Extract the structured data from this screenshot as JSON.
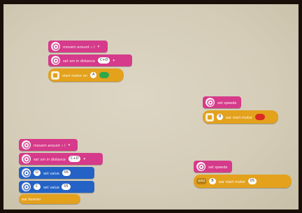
{
  "workspace": {
    "stack_top": {
      "block1": {
        "text": "ꞁ ∘ ʇunouɐ ɯǝʌoɯ",
        "dir": "▾"
      },
      "block2": {
        "text": "ǝɔuɐʇsᴉp uᴉ ɯʌ ʇǝs",
        "port": "C+D",
        "dir": "▾"
      },
      "block3": {
        "text": "uo ɹoʇoɯ ʇɹɐʇs",
        "port": "A",
        "dir": "▾"
      }
    },
    "stack_mid": {
      "block1": {
        "text": "ǝpǝǝds ʇǝs"
      },
      "block2": {
        "text": "ɹoʇoɯ ʇɹɐʇs ɹɐǝ",
        "port": "B",
        "dir": "▾"
      }
    },
    "stack_bottom_left": {
      "block1": {
        "text": "ꞁ ∘ ʇunouɐ ɯǝʌoɯ",
        "dir": "▾"
      },
      "block2": {
        "text": "ǝɔuɐʇsᴉp uᴉ ɯʌ ʇǝs",
        "port": "C+D",
        "dir": "▾"
      },
      "block3": {
        "text": "ǝnꞁɐʌ ʇǝs",
        "value": "05",
        "port": "D"
      },
      "block4": {
        "text": "ǝnꞁɐʌ ʇǝs",
        "value": "05",
        "port": "C"
      },
      "block5": {
        "text": "ɹǝʌǝɹoɟ ɹɐǝ"
      }
    },
    "stack_bottom_right": {
      "block1": {
        "text": "ǝpǝǝds ʇǝs"
      },
      "block2": {
        "text": "ɹoʇoɯ ʇɹɐʇs ɹɐǝ",
        "port": "B",
        "value": "05",
        "chip": "ʇuoɹ"
      }
    }
  },
  "colors": {
    "pink": "#d63a8a",
    "yellow": "#e3a11c",
    "blue": "#2463c5",
    "green": "#2fa84a",
    "red": "#d92b24"
  }
}
